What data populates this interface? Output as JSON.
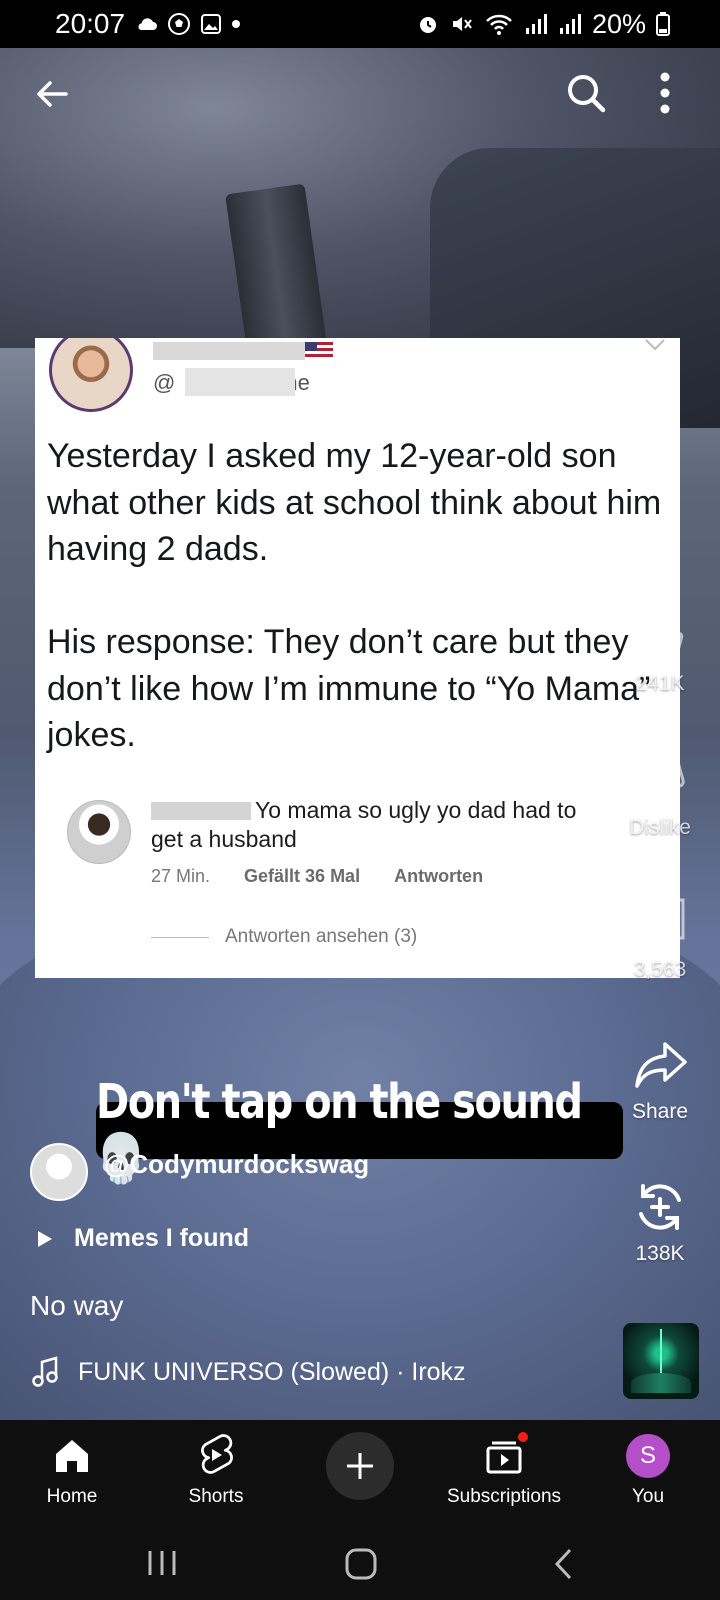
{
  "status_bar": {
    "time": "20:07",
    "battery": "20%"
  },
  "top_bar": {
    "icons": [
      "back-arrow-icon",
      "search-icon",
      "more-vert-icon"
    ]
  },
  "tweet": {
    "handle_suffix": "@",
    "handle_end": "he",
    "text": "Yesterday I asked my 12-year-old son what other kids at school think about him having 2 dads.\n\nHis response: They don’t care but they don’t like how I’m immune to “Yo Mama” jokes.",
    "reply": {
      "text": "Yo mama so ugly yo dad had to get a husband",
      "time": "27 Min.",
      "likes": "Gefällt 36 Mal",
      "reply_action": "Antworten",
      "view_replies": "Antworten ansehen (3)"
    }
  },
  "actions": {
    "like_count": "241K",
    "dislike_label": "Dislike",
    "comment_count": "3,563",
    "share_label": "Share",
    "remix_count": "138K"
  },
  "caption_banner": "Don't tap on the sound 💀",
  "channel": {
    "name": "@Codymurdockswag"
  },
  "playlist": "Memes I found",
  "video_title": "No way",
  "sound": "FUNK UNIVERSO (Slowed) · Irokz",
  "bottom_nav": {
    "home": "Home",
    "shorts": "Shorts",
    "subscriptions": "Subscriptions",
    "you": "You",
    "you_initial": "S"
  },
  "colors": {
    "nav_bg": "#0f0f0f",
    "you_avatar": "#b44fc9",
    "notification_dot": "#ff1a1a"
  }
}
